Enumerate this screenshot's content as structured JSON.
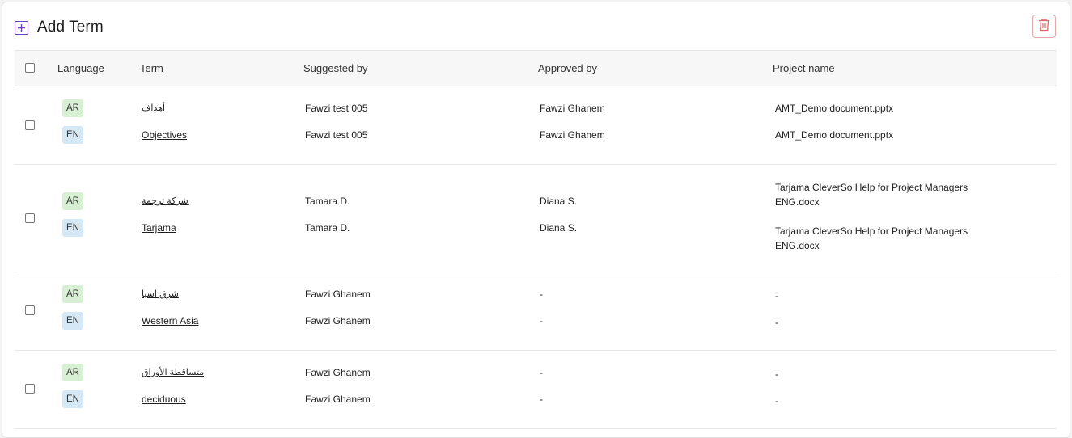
{
  "header": {
    "title": "Add Term"
  },
  "columns": {
    "language": "Language",
    "term": "Term",
    "suggested_by": "Suggested by",
    "approved_by": "Approved by",
    "project_name": "Project name"
  },
  "rows": [
    {
      "ar": {
        "lang": "AR",
        "term": "أهداف",
        "suggested_by": "Fawzi test 005",
        "approved_by": "Fawzi Ghanem",
        "project": "AMT_Demo document.pptx"
      },
      "en": {
        "lang": "EN",
        "term": "Objectives",
        "suggested_by": "Fawzi test 005",
        "approved_by": "Fawzi Ghanem",
        "project": "AMT_Demo document.pptx"
      }
    },
    {
      "ar": {
        "lang": "AR",
        "term": "شركة ترجمة",
        "suggested_by": "Tamara D.",
        "approved_by": "Diana S.",
        "project": "Tarjama CleverSo Help for Project Managers ENG.docx"
      },
      "en": {
        "lang": "EN",
        "term": "Tarjama",
        "suggested_by": "Tamara D.",
        "approved_by": "Diana S.",
        "project": "Tarjama CleverSo Help for Project Managers ENG.docx"
      }
    },
    {
      "ar": {
        "lang": "AR",
        "term": "شرق اسيا",
        "suggested_by": "Fawzi Ghanem",
        "approved_by": "-",
        "project": "-"
      },
      "en": {
        "lang": "EN",
        "term": "Western Asia",
        "suggested_by": "Fawzi Ghanem",
        "approved_by": "-",
        "project": "-"
      }
    },
    {
      "ar": {
        "lang": "AR",
        "term": "متساقطة الأوراق",
        "suggested_by": "Fawzi Ghanem",
        "approved_by": "-",
        "project": "-"
      },
      "en": {
        "lang": "EN",
        "term": "deciduous",
        "suggested_by": "Fawzi Ghanem",
        "approved_by": "-",
        "project": "-"
      }
    }
  ]
}
